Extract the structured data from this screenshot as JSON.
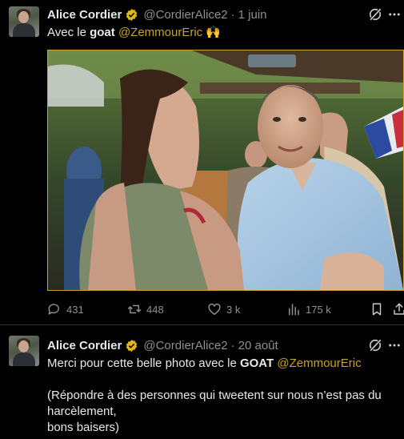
{
  "tweets": [
    {
      "author_name": "Alice Cordier",
      "handle": "@CordierAlice2",
      "separator": "·",
      "date": "1 juin",
      "text": {
        "prefix": "Avec le ",
        "bold": "goat",
        "space": " ",
        "mention": "@ZemmourEric",
        "emoji": " 🙌"
      },
      "actions": {
        "replies": "431",
        "retweets": "448",
        "likes": "3 k",
        "views": "175 k"
      },
      "icons": [
        "verified-badge-icon",
        "grok-icon",
        "more-icon",
        "reply-icon",
        "retweet-icon",
        "like-icon",
        "views-icon",
        "bookmark-icon",
        "share-icon"
      ]
    },
    {
      "author_name": "Alice Cordier",
      "handle": "@CordierAlice2",
      "separator": "·",
      "date": "20 août",
      "text": {
        "prefix": "Merci pour cette belle photo avec le ",
        "bold": "GOAT",
        "space": " ",
        "mention": "@ZemmourEric",
        "para_line1": "(Répondre à des personnes qui tweetent sur nous n’est pas du",
        "para_line2": "harcèlement,",
        "para_line3": "bons baisers)"
      },
      "icons": [
        "verified-badge-icon",
        "grok-icon",
        "more-icon"
      ]
    }
  ],
  "colors": {
    "background": "#000000",
    "text": "#e7e9ea",
    "muted": "#8b9196",
    "mention": "#c9a227",
    "verified_badge": "#e2b719",
    "divider": "#2f3336"
  }
}
